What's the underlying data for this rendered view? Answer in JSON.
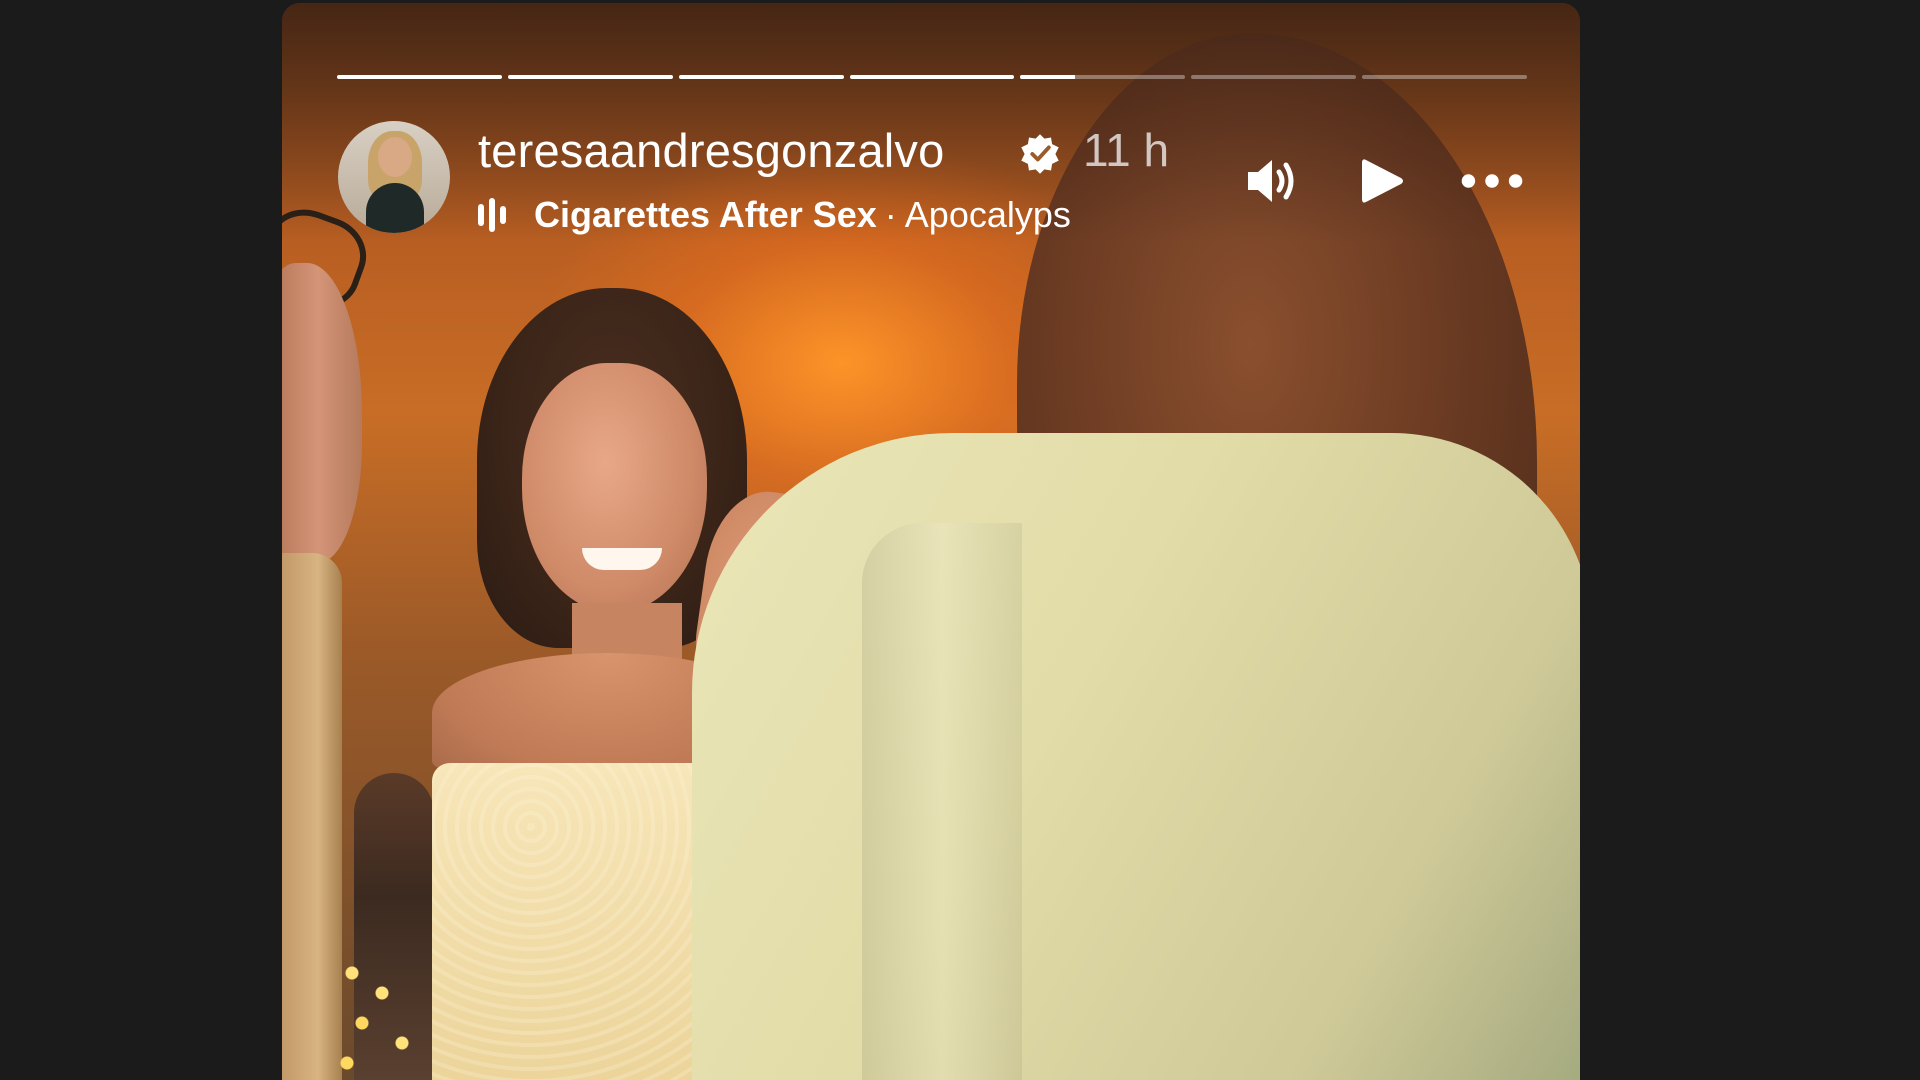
{
  "story": {
    "username": "teresaandresgonzalvo",
    "verified": true,
    "timestamp": "11 h",
    "music": {
      "artist": "Cigarettes After Sex",
      "separator": "·",
      "song": "Apocalyps"
    },
    "progress": {
      "segments": [
        1,
        1,
        1,
        1,
        0.33,
        0,
        0
      ]
    },
    "controls": {
      "mute_icon": "volume-icon",
      "play_icon": "play-icon",
      "more_icon": "more-options-icon"
    }
  },
  "colors": {
    "page_background": "#1b1b1c",
    "text_primary": "#ffffff"
  }
}
